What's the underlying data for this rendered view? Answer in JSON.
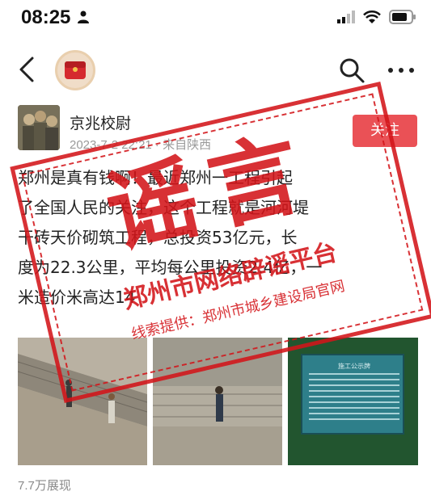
{
  "status_bar": {
    "time": "08:25",
    "icons": [
      "person-icon",
      "signal-icon",
      "wifi-icon",
      "battery-icon"
    ]
  },
  "nav_bar": {
    "icons": [
      "back-icon",
      "app-logo-icon",
      "search-icon",
      "more-icon"
    ]
  },
  "post": {
    "author": "京兆校尉",
    "meta": "2023-7-2 22:21 · 来自陕西",
    "follow_label": "关注",
    "body_lines": [
      "郑州是真有钱啊！最近郑州一工程引起",
      "了全国人民的关注，这个工程就是河河堤",
      "干砖天价砌筑工程，总投资53亿元，长",
      "度为22.3公里，平均每公里投资2.4亿，一",
      "米造价米高达14"
    ],
    "view_count": "7.7万展现",
    "notice_title": "施工公示牌"
  },
  "stamp": {
    "big_text": "谣言",
    "platform": "郑州市网络辟谣平台",
    "source": "线索提供：郑州市城乡建设局官网"
  },
  "colors": {
    "stamp_red": "#d3151a",
    "follow_bg": "#ea5156",
    "notice_board": "#2e7f8a"
  }
}
